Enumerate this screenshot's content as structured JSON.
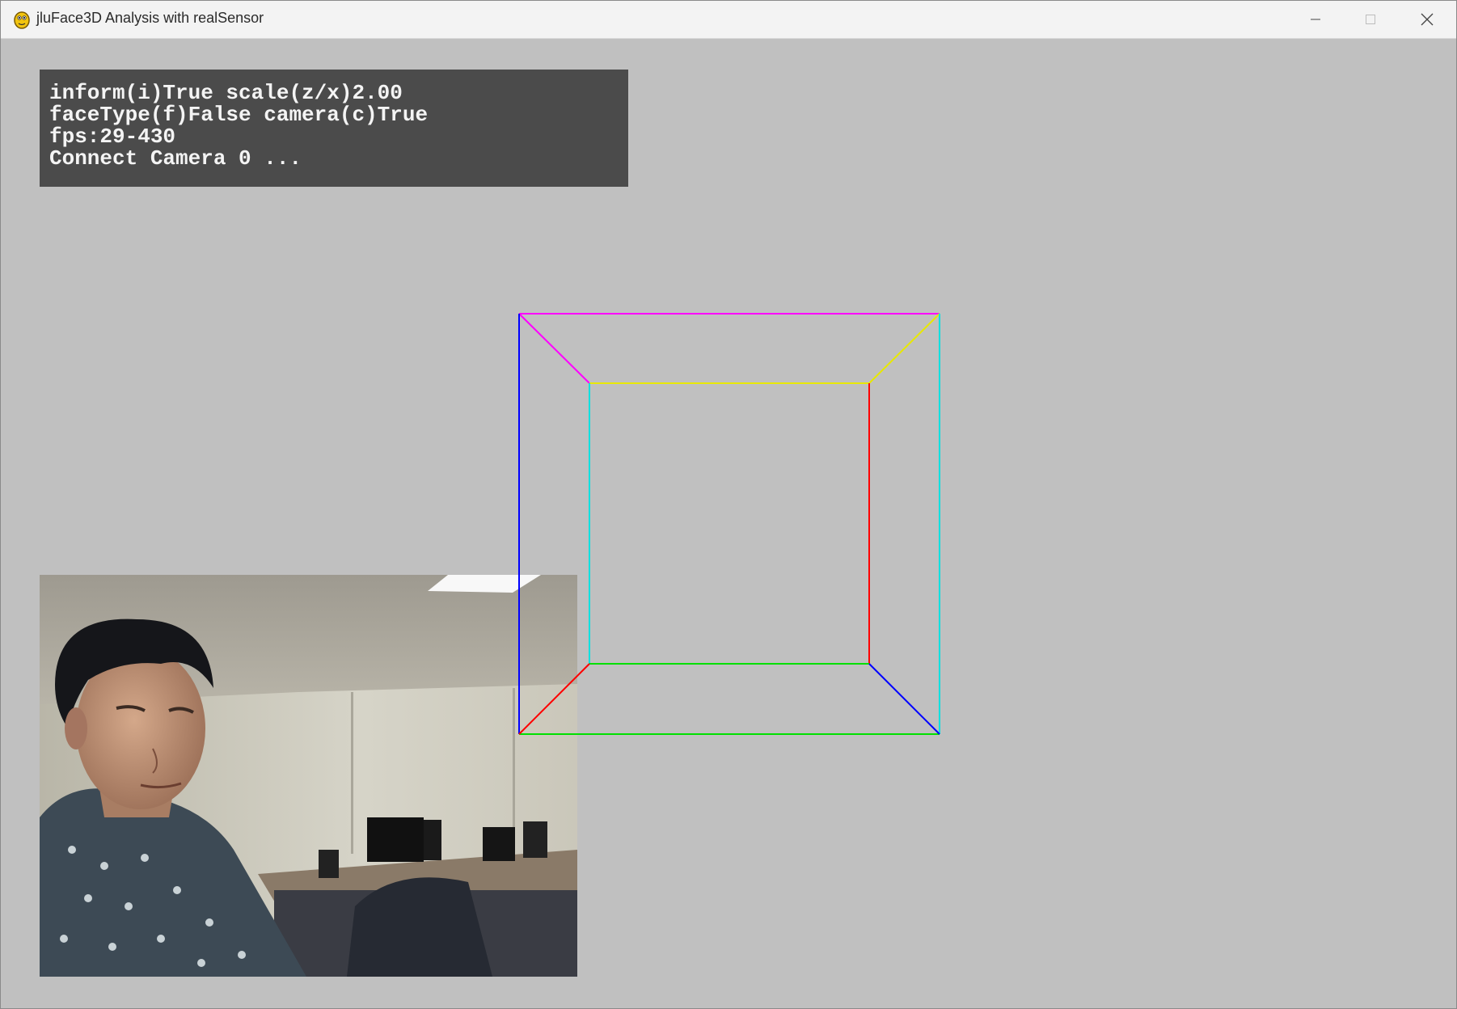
{
  "window": {
    "title": "jluFace3D Analysis with realSensor",
    "app_icon": "pygame-snake-icon",
    "controls": {
      "minimize_icon": "minimize-icon",
      "maximize_icon": "maximize-icon",
      "close_icon": "close-icon"
    }
  },
  "info": {
    "line1": "inform(i)True scale(z/x)2.00",
    "line2": "faceType(f)False camera(c)True",
    "line3": "fps:29-430",
    "line4": "Connect Camera 0 ..."
  },
  "colors": {
    "background": "#c0c0c0",
    "panel": "#4b4b4b",
    "panel_text": "#f4f4f4",
    "cube_top": "#ff00ff",
    "cube_inner_top": "#e8e800",
    "cube_left": "#0000ff",
    "cube_right_inner": "#ff0000",
    "cube_right_outer": "#00e0e0",
    "cube_bottom": "#00e000"
  }
}
